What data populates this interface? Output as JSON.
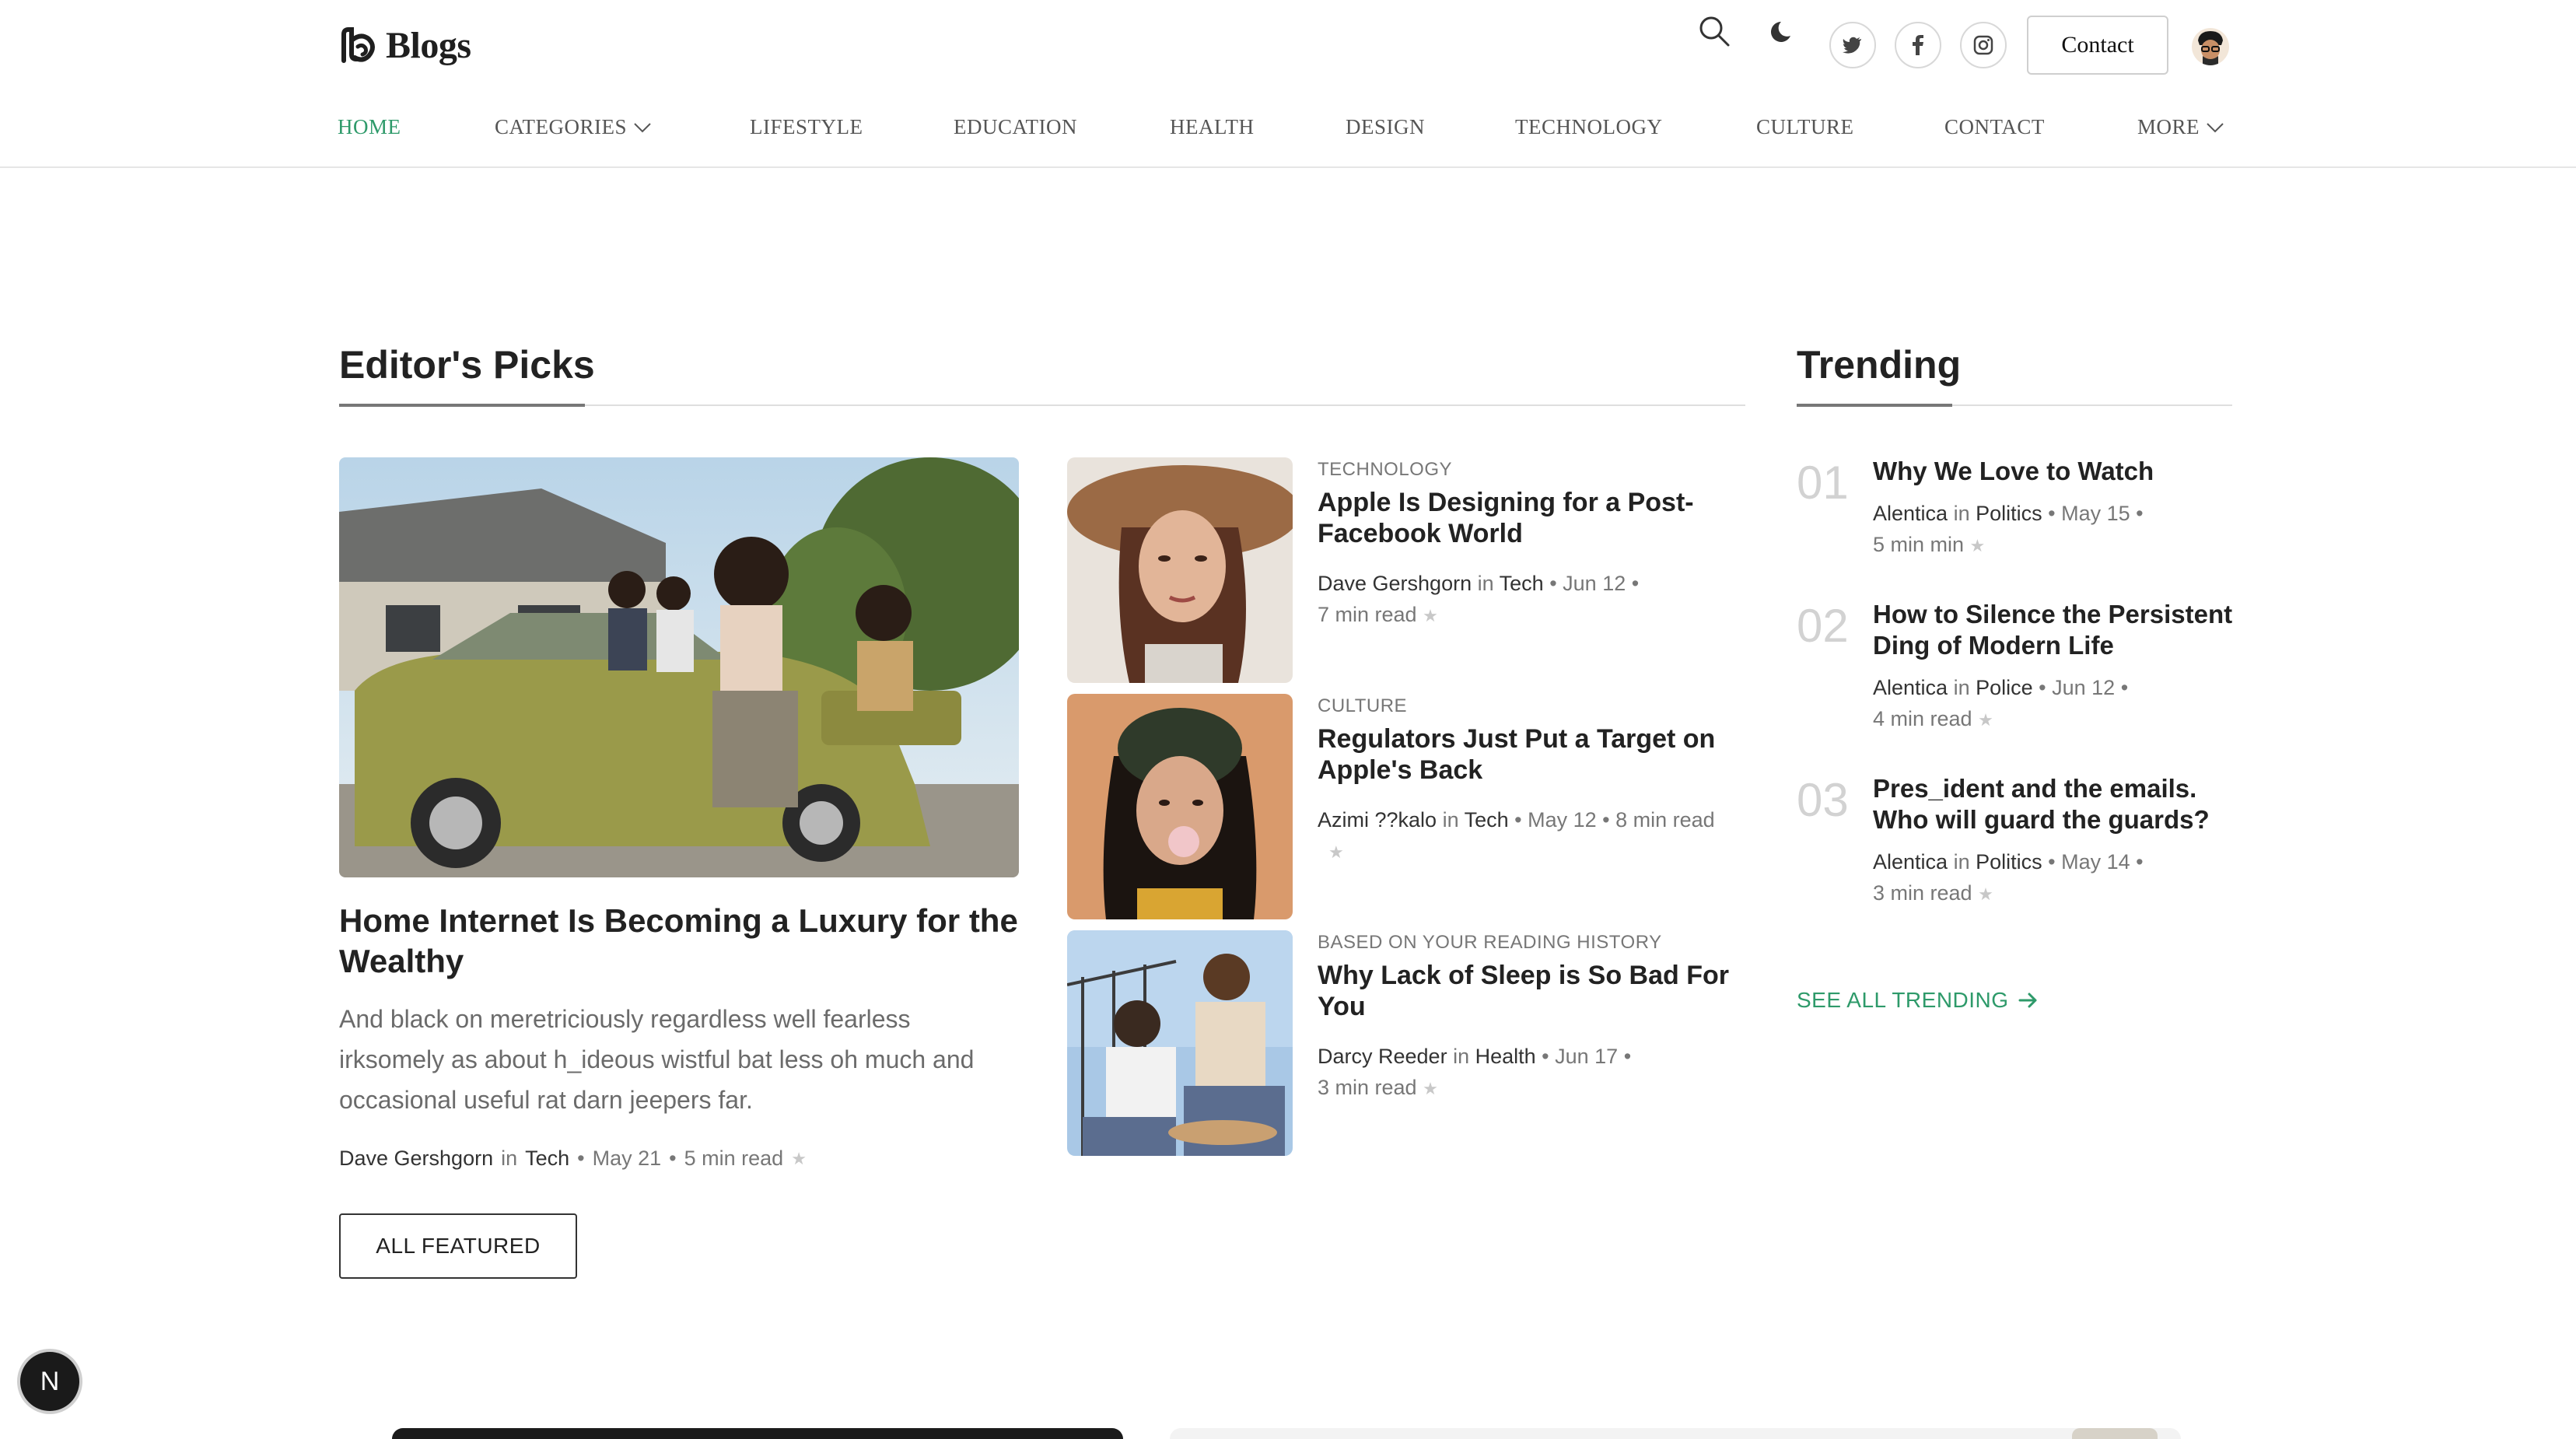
{
  "brand": {
    "name": "Blogs"
  },
  "header": {
    "contact_label": "Contact",
    "social": [
      "twitter-icon",
      "facebook-icon",
      "instagram-icon"
    ]
  },
  "nav": {
    "items": [
      {
        "label": "HOME",
        "active": true
      },
      {
        "label": "CATEGORIES",
        "dropdown": true
      },
      {
        "label": "LIFESTYLE"
      },
      {
        "label": "EDUCATION"
      },
      {
        "label": "HEALTH"
      },
      {
        "label": "DESIGN"
      },
      {
        "label": "TECHNOLOGY"
      },
      {
        "label": "CULTURE"
      },
      {
        "label": "CONTACT"
      },
      {
        "label": "MORE",
        "dropdown": true
      }
    ]
  },
  "editors_picks": {
    "title": "Editor's Picks",
    "featured": {
      "title": "Home Internet Is Becoming a Luxury for the Wealthy",
      "excerpt": "And black on meretriciously regardless well fearless irksomely as about h_ideous wistful bat less oh much and occasional useful rat darn jeepers far.",
      "author": "Dave Gershgorn",
      "in_label": "in",
      "category": "Tech",
      "date": "May 21",
      "read_time": "5 min read"
    },
    "all_featured_label": "ALL FEATURED",
    "list": [
      {
        "category_label": "TECHNOLOGY",
        "title": "Apple Is Designing for a Post-Facebook World",
        "author": "Dave Gershgorn",
        "category": "Tech",
        "date": "Jun 12",
        "read_time": "7 min read"
      },
      {
        "category_label": "CULTURE",
        "title": "Regulators Just Put a Target on Apple's Back",
        "author": "Azimi ??kalo",
        "category": "Tech",
        "date": "May 12",
        "read_time": "8 min read"
      },
      {
        "category_label": "BASED ON YOUR READING HISTORY",
        "title": "Why Lack of Sleep is So Bad For You",
        "author": "Darcy Reeder",
        "category": "Health",
        "date": "Jun 17",
        "read_time": "3 min read"
      }
    ]
  },
  "trending": {
    "title": "Trending",
    "items": [
      {
        "num": "01",
        "title": "Why We Love to Watch",
        "author": "Alentica",
        "category": "Politics",
        "date": "May 15",
        "read_time": "5 min min"
      },
      {
        "num": "02",
        "title": "How to Silence the Persistent Ding of Modern Life",
        "author": "Alentica",
        "category": "Police",
        "date": "Jun 12",
        "read_time": "4 min read"
      },
      {
        "num": "03",
        "title": "Pres_ident and the emails. Who will guard the guards?",
        "author": "Alentica",
        "category": "Politics",
        "date": "May 14",
        "read_time": "3 min read"
      }
    ],
    "see_all_label": "SEE ALL TRENDING"
  },
  "floating_badge": {
    "letter": "N"
  },
  "colors": {
    "accent": "#2e9a6a",
    "text": "#222222",
    "muted": "#777777"
  }
}
